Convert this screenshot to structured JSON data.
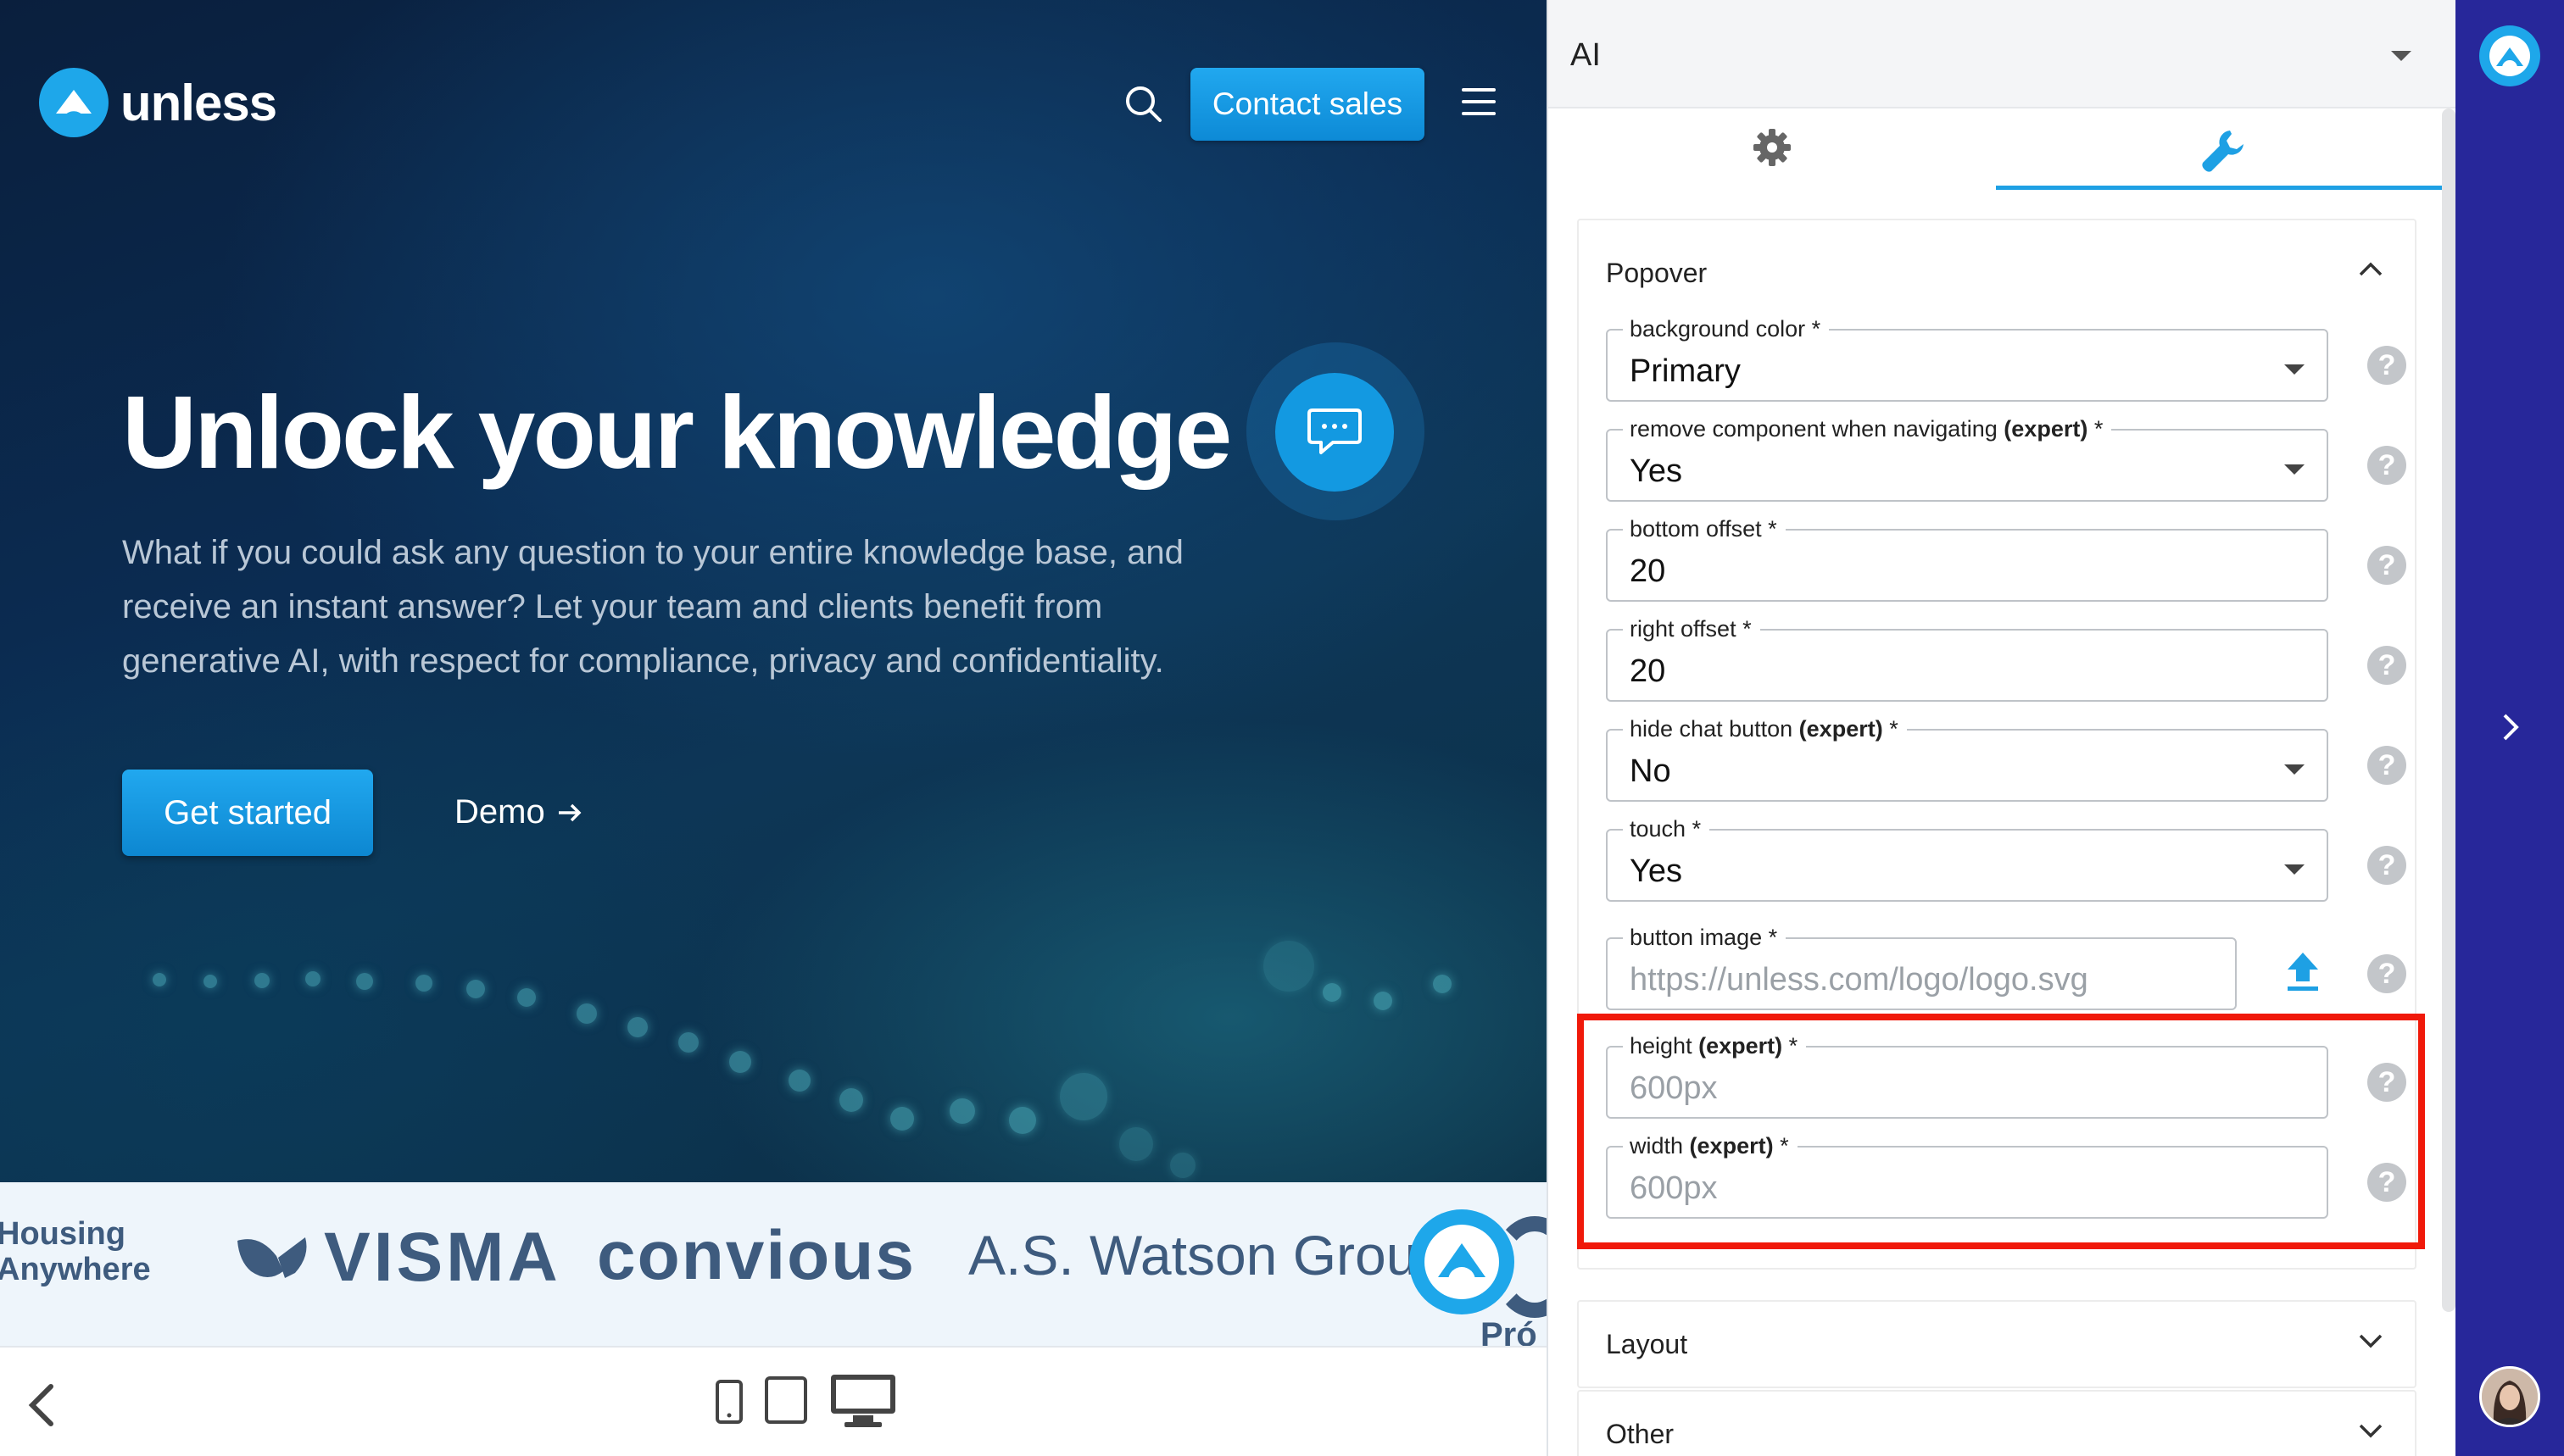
{
  "site": {
    "brand": "unless",
    "contact_label": "Contact sales",
    "hero_title": "Unlock your knowledge",
    "hero_description": "What if you could ask any question to your entire knowledge base, and receive an instant answer? Let your team and clients benefit from generative AI, with respect for compliance, privacy and confidentiality.",
    "get_started_label": "Get started",
    "demo_label": "Demo",
    "logos": {
      "housing_line1": "Housing",
      "housing_line2": "Anywhere",
      "visma": "VISMA",
      "convious": "convious",
      "watson": "A.S. Watson Group",
      "partial": "Pró"
    }
  },
  "panel": {
    "title": "AI",
    "tabs": [
      "settings",
      "tools"
    ],
    "active_tab": "tools",
    "section_title": "Popover",
    "fields": [
      {
        "label": "background color",
        "expert": false,
        "required": "*",
        "value": "Primary",
        "type": "select"
      },
      {
        "label": "remove component when navigating",
        "expert": true,
        "required": "*",
        "value": "Yes",
        "type": "select"
      },
      {
        "label": "bottom offset",
        "expert": false,
        "required": "*",
        "value": "20",
        "type": "text"
      },
      {
        "label": "right offset",
        "expert": false,
        "required": "*",
        "value": "20",
        "type": "text"
      },
      {
        "label": "hide chat button",
        "expert": true,
        "required": "*",
        "value": "No",
        "type": "select"
      },
      {
        "label": "touch",
        "expert": false,
        "required": "*",
        "value": "Yes",
        "type": "select"
      },
      {
        "label": "button image",
        "expert": false,
        "required": "*",
        "placeholder": "https://unless.com/logo/logo.svg",
        "type": "upload"
      },
      {
        "label": "height",
        "expert": true,
        "required": "*",
        "placeholder": "600px",
        "type": "text"
      },
      {
        "label": "width",
        "expert": true,
        "required": "*",
        "placeholder": "600px",
        "type": "text"
      }
    ],
    "expert_tag": "(expert)",
    "help_glyph": "?",
    "collapsed_sections": [
      "Layout",
      "Other"
    ]
  },
  "colors": {
    "accent": "#1ea0e4",
    "highlight": "#f0190a",
    "rail": "#27279a"
  }
}
